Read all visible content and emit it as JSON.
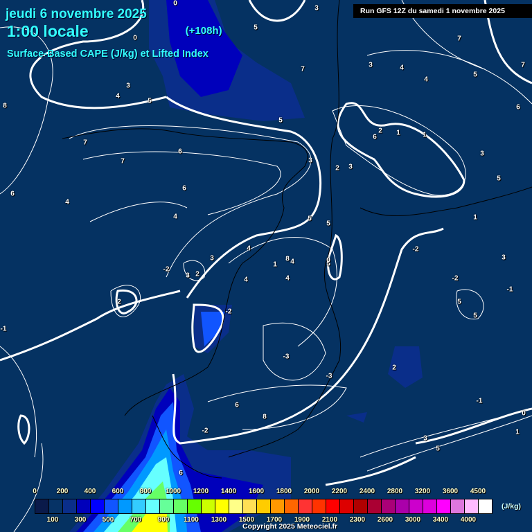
{
  "header": {
    "date": "jeudi 6 novembre 2025",
    "time": "1:00 locale",
    "lead": "(+108h)",
    "subtitle": "Surface-Based CAPE (J/kg) et Lifted Index",
    "run": "Run GFS 12Z du samedi 1 novembre 2025"
  },
  "legend": {
    "unit": "(J/kg)",
    "top_ticks": [
      "0",
      "200",
      "400",
      "600",
      "800",
      "1000",
      "1200",
      "1400",
      "1600",
      "1800",
      "2000",
      "2200",
      "2400",
      "2800",
      "3200",
      "3600",
      "4500"
    ],
    "bottom_ticks": [
      "100",
      "300",
      "500",
      "700",
      "900",
      "1100",
      "1300",
      "1500",
      "1700",
      "1900",
      "2100",
      "2300",
      "2600",
      "3000",
      "3400",
      "4000"
    ],
    "colors": [
      "#0a1a4a",
      "#063366",
      "#0a2e8a",
      "#0000bb",
      "#0000ff",
      "#1155ff",
      "#0099ff",
      "#33ccff",
      "#66ffff",
      "#66ff99",
      "#66ff66",
      "#66ff00",
      "#ccff00",
      "#ffff00",
      "#ffff88",
      "#ffe055",
      "#ffcc00",
      "#ff9900",
      "#ff6600",
      "#ff3333",
      "#ff3300",
      "#ff0000",
      "#dd0000",
      "#b00000",
      "#aa0033",
      "#aa0077",
      "#aa00aa",
      "#cc00cc",
      "#dd00dd",
      "#ff00ff",
      "#dd77dd",
      "#ffbbff",
      "#ffffff"
    ]
  },
  "lifted_index_labels": [
    "0",
    "0",
    "3",
    "5",
    "3",
    "4",
    "5",
    "7",
    "8",
    "7",
    "6",
    "7",
    "6",
    "4",
    "6",
    "4",
    "7",
    "5",
    "3",
    "4",
    "4",
    "7",
    "6",
    "5",
    "2",
    "6",
    "1",
    "1",
    "3",
    "5",
    "3",
    "2",
    "5",
    "3",
    "5",
    "4",
    "1",
    "8",
    "4",
    "5",
    "0",
    "4",
    "3",
    "4",
    "3",
    "-2",
    "1",
    "-2",
    "2",
    "2",
    "-2",
    "-1",
    "-1",
    "-2",
    "-3",
    "2",
    "-3",
    "3",
    "5",
    "5",
    "6",
    "8",
    "-2",
    "-1",
    "0",
    "1",
    "3",
    "5",
    "6"
  ],
  "copyright": "Copyright 2025 Meteociel.fr"
}
